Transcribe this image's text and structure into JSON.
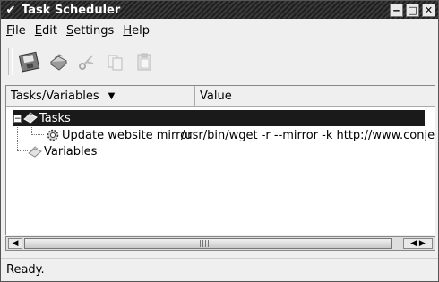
{
  "window": {
    "title": "Task Scheduler",
    "menu_glyph": "✔",
    "minimize_glyph": "‒",
    "maximize_glyph": "□",
    "close_glyph": "✕"
  },
  "menubar": {
    "items": [
      {
        "accel": "F",
        "rest": "ile"
      },
      {
        "accel": "E",
        "rest": "dit"
      },
      {
        "accel": "S",
        "rest": "ettings"
      },
      {
        "accel": "H",
        "rest": "elp"
      }
    ]
  },
  "toolbar": {
    "buttons": [
      "save-icon",
      "print-icon",
      "cut-icon",
      "copy-icon",
      "paste-icon"
    ]
  },
  "tree": {
    "columns": [
      "Tasks/Variables",
      "Value"
    ],
    "sort_arrow": "▼",
    "rows": [
      {
        "label": "Tasks",
        "expander": "−"
      },
      {
        "label": "Update website mirror",
        "value": "/usr/bin/wget -r --mirror -k http://www.conje"
      },
      {
        "label": "Variables"
      }
    ]
  },
  "scrollbar": {
    "left_arrow": "◀",
    "right_arrow": "◀ ▶"
  },
  "status": {
    "text": "Ready."
  }
}
